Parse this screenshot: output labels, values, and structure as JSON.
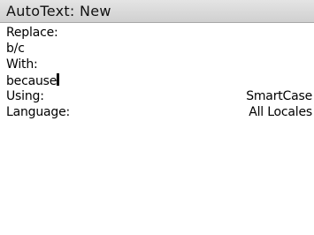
{
  "title": "AutoText: New",
  "form": {
    "replace_label": "Replace:",
    "replace_value": "b/c",
    "with_label": "With:",
    "with_value": "because",
    "using_label": "Using:",
    "using_value": "SmartCase",
    "language_label": "Language:",
    "language_value": "All Locales"
  }
}
